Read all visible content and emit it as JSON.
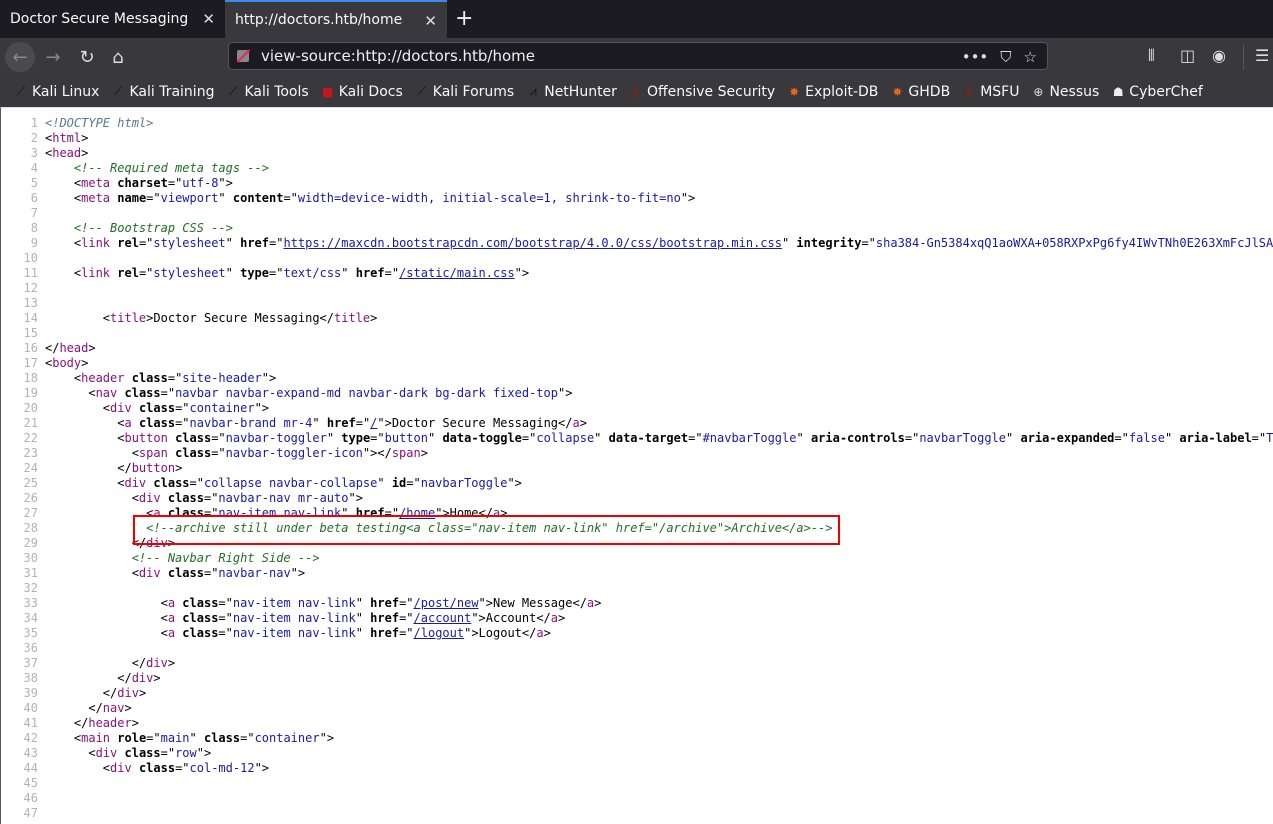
{
  "tabs": [
    {
      "label": "Doctor Secure Messaging",
      "active": false
    },
    {
      "label": "http://doctors.htb/home",
      "active": true
    }
  ],
  "toolbar": {
    "url": "view-source:http://doctors.htb/home",
    "more": "•••"
  },
  "bookmarks": [
    {
      "label": "Kali Linux",
      "icon": "kali-dragon-icon"
    },
    {
      "label": "Kali Training",
      "icon": "kali-dragon-icon"
    },
    {
      "label": "Kali Tools",
      "icon": "kali-dragon-icon"
    },
    {
      "label": "Kali Docs",
      "icon": "kali-docs-icon"
    },
    {
      "label": "Kali Forums",
      "icon": "kali-dragon-icon"
    },
    {
      "label": "NetHunter",
      "icon": "nethunter-icon"
    },
    {
      "label": "Offensive Security",
      "icon": "offsec-icon"
    },
    {
      "label": "Exploit-DB",
      "icon": "exploitdb-bug-icon"
    },
    {
      "label": "GHDB",
      "icon": "exploitdb-bug-icon"
    },
    {
      "label": "MSFU",
      "icon": "offsec-icon"
    },
    {
      "label": "Nessus",
      "icon": "globe-icon"
    },
    {
      "label": "CyberChef",
      "icon": "chef-hat-icon"
    }
  ],
  "colors": {
    "tag": "#881280",
    "attr_value": "#1a1aa6",
    "comment": "#236e25",
    "highlight_box": "#e00000",
    "tab_accent": "#3a8cf0"
  },
  "highlighted_line": 28,
  "source": [
    "<!DOCTYPE html>",
    "<html>",
    "<head>",
    "    <!-- Required meta tags -->",
    "    <meta charset=\"utf-8\">",
    "    <meta name=\"viewport\" content=\"width=device-width, initial-scale=1, shrink-to-fit=no\">",
    "",
    "    <!-- Bootstrap CSS -->",
    "    <link rel=\"stylesheet\" href=\"https://maxcdn.bootstrapcdn.com/bootstrap/4.0.0/css/bootstrap.min.css\" integrity=\"sha384-Gn5384xqQ1aoWXA+058RXPxPg6fy4IWvTNh0E263XmFcJlSA",
    "",
    "    <link rel=\"stylesheet\" type=\"text/css\" href=\"/static/main.css\">",
    "",
    "",
    "        <title>Doctor Secure Messaging</title>",
    "",
    "</head>",
    "<body>",
    "    <header class=\"site-header\">",
    "      <nav class=\"navbar navbar-expand-md navbar-dark bg-dark fixed-top\">",
    "        <div class=\"container\">",
    "          <a class=\"navbar-brand mr-4\" href=\"/\">Doctor Secure Messaging</a>",
    "          <button class=\"navbar-toggler\" type=\"button\" data-toggle=\"collapse\" data-target=\"#navbarToggle\" aria-controls=\"navbarToggle\" aria-expanded=\"false\" aria-label=\"T",
    "            <span class=\"navbar-toggler-icon\"></span>",
    "          </button>",
    "          <div class=\"collapse navbar-collapse\" id=\"navbarToggle\">",
    "            <div class=\"navbar-nav mr-auto\">",
    "              <a class=\"nav-item nav-link\" href=\"/home\">Home</a>",
    "              <!--archive still under beta testing<a class=\"nav-item nav-link\" href=\"/archive\">Archive</a>-->",
    "            </div>",
    "            <!-- Navbar Right Side -->",
    "            <div class=\"navbar-nav\">",
    "",
    "                <a class=\"nav-item nav-link\" href=\"/post/new\">New Message</a>",
    "                <a class=\"nav-item nav-link\" href=\"/account\">Account</a>",
    "                <a class=\"nav-item nav-link\" href=\"/logout\">Logout</a>",
    "",
    "            </div>",
    "          </div>",
    "        </div>",
    "      </nav>",
    "    </header>",
    "    <main role=\"main\" class=\"container\">",
    "      <div class=\"row\">",
    "        <div class=\"col-md-12\">",
    "",
    "",
    ""
  ]
}
